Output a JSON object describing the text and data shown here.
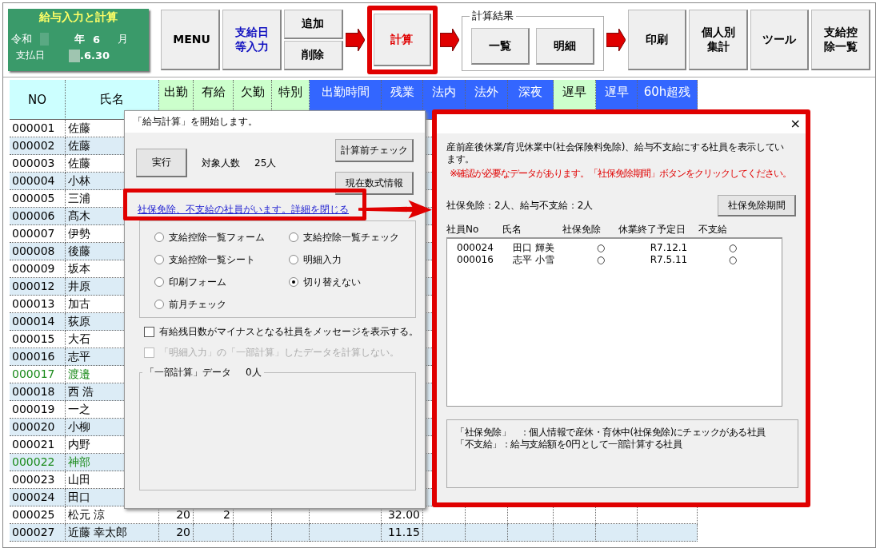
{
  "header": {
    "title": "給与入力と計算",
    "era": "令和",
    "year_label": "年",
    "month": "6",
    "month_label": "月",
    "pay_date_label": "支払日",
    "pay_date": ".6.30"
  },
  "toolbar": [
    {
      "kind": "button",
      "label": "MENU",
      "color": "#000000",
      "highlighted": false
    },
    {
      "kind": "button",
      "label": "支給日等入力",
      "color": "#1010c0",
      "highlighted": false
    },
    {
      "kind": "stack",
      "buttons": [
        "追加",
        "削除"
      ]
    },
    {
      "kind": "arrow"
    },
    {
      "kind": "button",
      "label": "計算",
      "color": "#e00000",
      "highlighted": true
    },
    {
      "kind": "arrow"
    },
    {
      "kind": "group",
      "title": "計算結果",
      "buttons": [
        "一覧",
        "明細"
      ]
    },
    {
      "kind": "arrow"
    },
    {
      "kind": "button",
      "label": "印刷",
      "color": "#000000",
      "highlighted": false
    },
    {
      "kind": "button",
      "label": "個人別集計",
      "color": "#000000",
      "highlighted": false
    },
    {
      "kind": "button",
      "label": "ツール",
      "color": "#000000",
      "highlighted": false
    },
    {
      "kind": "button",
      "label": "支給控除一覧",
      "color": "#000000",
      "highlighted": false
    }
  ],
  "sheet": {
    "columns": [
      {
        "label": "NO",
        "kind": "key"
      },
      {
        "label": "氏名",
        "kind": "key"
      },
      {
        "label": "出勤",
        "kind": "count"
      },
      {
        "label": "有給",
        "kind": "count"
      },
      {
        "label": "欠勤",
        "kind": "count"
      },
      {
        "label": "特別",
        "kind": "count"
      },
      {
        "label": "出勤時間",
        "kind": "time"
      },
      {
        "label": "残業",
        "kind": "time"
      },
      {
        "label": "法内",
        "kind": "time"
      },
      {
        "label": "法外",
        "kind": "time"
      },
      {
        "label": "深夜",
        "kind": "time"
      },
      {
        "label": "遅早",
        "kind": "count"
      },
      {
        "label": "遅早",
        "kind": "time"
      },
      {
        "label": "60h超残",
        "kind": "time"
      }
    ],
    "rows": [
      {
        "no": "000001",
        "name": "佐藤",
        "color": "#000000"
      },
      {
        "no": "000002",
        "name": "佐藤",
        "color": "#000000"
      },
      {
        "no": "000003",
        "name": "佐藤",
        "color": "#000000"
      },
      {
        "no": "000004",
        "name": "小林",
        "color": "#000000"
      },
      {
        "no": "000005",
        "name": "三浦",
        "color": "#000000"
      },
      {
        "no": "000006",
        "name": "髙木",
        "color": "#000000"
      },
      {
        "no": "000007",
        "name": "伊勢",
        "color": "#000000"
      },
      {
        "no": "000008",
        "name": "後藤",
        "color": "#000000"
      },
      {
        "no": "000009",
        "name": "坂本",
        "color": "#000000"
      },
      {
        "no": "000012",
        "name": "井原",
        "color": "#000000"
      },
      {
        "no": "000013",
        "name": "加古",
        "color": "#000000"
      },
      {
        "no": "000014",
        "name": "荻原",
        "color": "#000000"
      },
      {
        "no": "000015",
        "name": "大石",
        "color": "#000000"
      },
      {
        "no": "000016",
        "name": "志平",
        "color": "#000000"
      },
      {
        "no": "000017",
        "name": "渡邉",
        "color": "#1a8a1a"
      },
      {
        "no": "000018",
        "name": "西 浩",
        "color": "#000000"
      },
      {
        "no": "000019",
        "name": "一之",
        "color": "#000000"
      },
      {
        "no": "000020",
        "name": "小柳",
        "color": "#000000"
      },
      {
        "no": "000021",
        "name": "内野",
        "color": "#000000"
      },
      {
        "no": "000022",
        "name": "神部",
        "color": "#1a8a1a"
      },
      {
        "no": "000023",
        "name": "山田",
        "color": "#000000"
      },
      {
        "no": "000024",
        "name": "田口",
        "color": "#000000"
      },
      {
        "no": "000025",
        "name": "松元 涼",
        "color": "#000000",
        "attendance_days": "20",
        "paid_days": "2",
        "overtime_hours": "32.00"
      },
      {
        "no": "000027",
        "name": "近藤 幸太郎",
        "color": "#000000",
        "attendance_days": "20",
        "overtime_hours": "11.15"
      }
    ]
  },
  "calc_dialog": {
    "title": "「給与計算」を開始します。",
    "run_button": "実行",
    "target_label": "対象人数",
    "target_count": "25人",
    "precheck_button": "計算前チェック",
    "formula_button": "現在数式情報",
    "link": "社保免除、不支給の社員がいます。詳細を閉じる",
    "options": [
      {
        "label": "支給控除一覧フォーム",
        "selected": false
      },
      {
        "label": "支給控除一覧チェック",
        "selected": false
      },
      {
        "label": "支給控除一覧シート",
        "selected": false
      },
      {
        "label": "明細入力",
        "selected": false
      },
      {
        "label": "印刷フォーム",
        "selected": false
      },
      {
        "label": "切り替えない",
        "selected": true
      },
      {
        "label": "前月チェック",
        "selected": false
      }
    ],
    "checkboxes": [
      {
        "label": "有給残日数がマイナスとなる社員をメッセージを表示する。",
        "checked": false,
        "disabled": false
      },
      {
        "label": "「明細入力」の「一部計算」したデータを計算しない。",
        "checked": false,
        "disabled": true
      }
    ],
    "partial_group": {
      "title": "「一部計算」データ",
      "count": "0人"
    }
  },
  "exempt_dialog": {
    "close": "×",
    "message": "産前産後休業/育児休業中(社会保険料免除)、給与不支給にする社員を表示しています。",
    "warning": "※確認が必要なデータがあります。「社保免除期間」ボタンをクリックしてください。",
    "summary": "社保免除：2人、給与不支給：2人",
    "period_button": "社保免除期間",
    "columns": [
      "社員No",
      "氏名",
      "社保免除",
      "休業終了予定日",
      "不支給"
    ],
    "rows": [
      {
        "no": "000024",
        "name": "田口 輝美",
        "exempt": "○",
        "end_date": "R7.12.1",
        "unpaid": "○"
      },
      {
        "no": "000016",
        "name": "志平 小雪",
        "exempt": "○",
        "end_date": "R7.5.11",
        "unpaid": "○"
      }
    ],
    "notes": [
      "「社保免除」　：個人情報で産休・育休中(社保免除)にチェックがある社員",
      "「不支給」：給与支給額を0円として一部計算する社員"
    ]
  }
}
